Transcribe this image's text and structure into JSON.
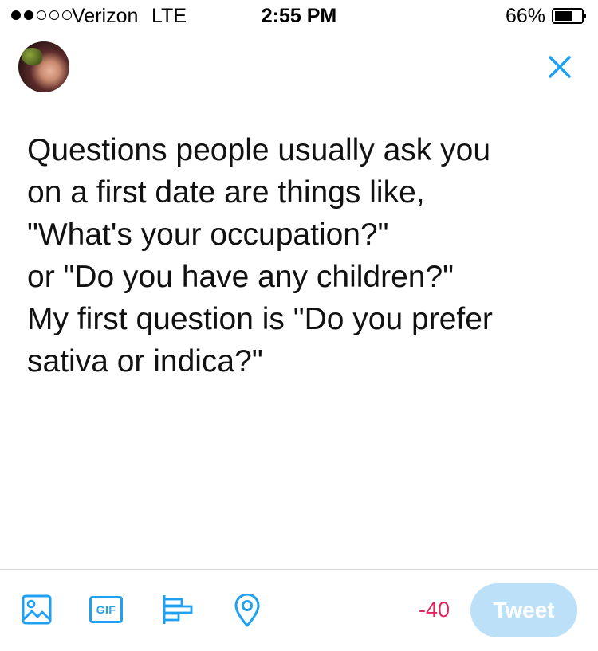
{
  "status_bar": {
    "signal_filled": 2,
    "signal_total": 5,
    "carrier": "Verizon",
    "network": "LTE",
    "time": "2:55 PM",
    "battery_percent": "66%",
    "battery_level": 0.66
  },
  "compose": {
    "close_icon": "close-icon",
    "text_lines": [
      "Questions people usually ask you",
      "on a first date are things like,",
      "\"What's your occupation?\"",
      "or \"Do you have any children?\"",
      "My first question is \"Do you prefer",
      "sativa or indica?\""
    ]
  },
  "toolbar": {
    "icons": [
      "image-icon",
      "gif-icon",
      "poll-icon",
      "location-icon"
    ],
    "gif_label": "GIF",
    "char_counter": "-40",
    "tweet_label": "Tweet"
  },
  "colors": {
    "accent": "#1da1f2",
    "counter_over_limit": "#e0245e",
    "tweet_button_disabled": "#bbe0f7"
  }
}
